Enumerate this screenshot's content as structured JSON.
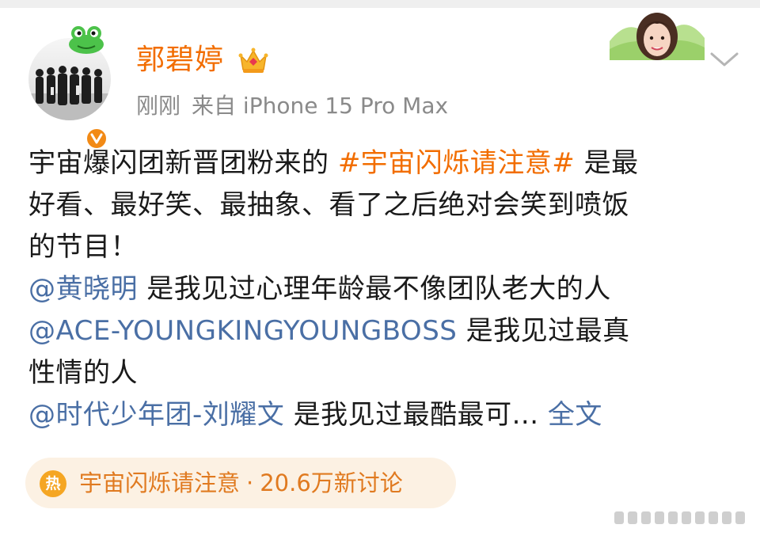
{
  "post": {
    "author": "郭碧婷",
    "time": "刚刚",
    "source": "来自 iPhone 15 Pro Max",
    "lines": [
      [
        {
          "text": "宇宙爆闪团新晋团粉来的 ",
          "kind": "text"
        },
        {
          "text": "#宇宙闪烁请注意#",
          "kind": "topic"
        },
        {
          "text": " 是最",
          "kind": "text"
        }
      ],
      [
        {
          "text": "好看、最好笑、最抽象、看了之后绝对会笑到喷饭",
          "kind": "text"
        }
      ],
      [
        {
          "text": "的节目！",
          "kind": "text"
        }
      ],
      [
        {
          "text": "@黄晓明",
          "kind": "mention"
        },
        {
          "text": " 是我见过心理年龄最不像团队老大的人",
          "kind": "text"
        }
      ],
      [
        {
          "text": "@ACE-YOUNGKINGYOUNGBOSS",
          "kind": "mention"
        },
        {
          "text": " 是我见过最真",
          "kind": "text"
        }
      ],
      [
        {
          "text": "性情的人",
          "kind": "text"
        }
      ],
      [
        {
          "text": "@时代少年团-刘耀文",
          "kind": "mention"
        },
        {
          "text": " 是我见过最酷最可... ",
          "kind": "text"
        },
        {
          "text": "全文",
          "kind": "more"
        }
      ]
    ]
  },
  "topic_pill": {
    "badge": "热",
    "name": "宇宙闪烁请注意",
    "separator": "·",
    "stats": "20.6万新讨论"
  },
  "icons": {
    "avatar": "group-photo-avatar",
    "verified": "verified-badge-icon",
    "crown": "crown-icon",
    "decoration": "card-decoration-portrait",
    "menu": "chevron-down-icon"
  },
  "colors": {
    "accent": "#f26d00",
    "mention": "#4a6fa5",
    "meta": "#8a8a8a",
    "pill_bg": "#fcf1e3"
  }
}
